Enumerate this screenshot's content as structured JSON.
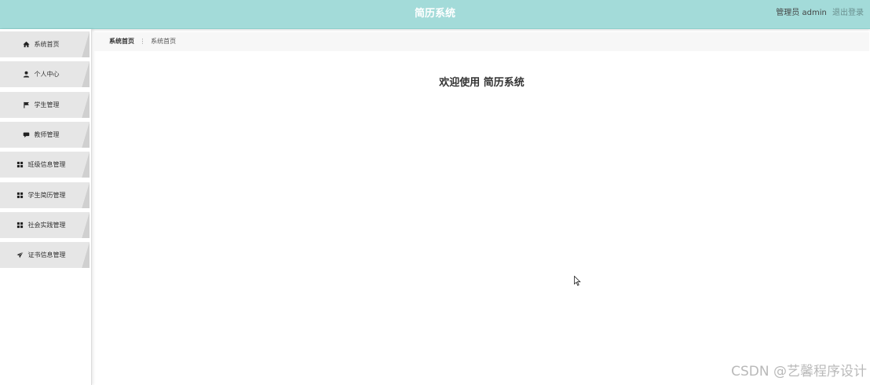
{
  "header": {
    "title": "简历系统",
    "user_label": "管理员 admin",
    "logout_label": "退出登录",
    "background_color": "#a3dbd9"
  },
  "sidebar": {
    "items": [
      {
        "label": "系统首页",
        "icon": "home-icon"
      },
      {
        "label": "个人中心",
        "icon": "user-icon"
      },
      {
        "label": "学生管理",
        "icon": "flag-icon"
      },
      {
        "label": "教师管理",
        "icon": "chat-icon"
      },
      {
        "label": "班级信息管理",
        "icon": "grid-icon"
      },
      {
        "label": "学生简历管理",
        "icon": "grid-icon"
      },
      {
        "label": "社会实践管理",
        "icon": "grid-icon"
      },
      {
        "label": "证书信息管理",
        "icon": "send-icon"
      }
    ]
  },
  "breadcrumb": {
    "first": "系统首页",
    "separator": "⋮",
    "second": "系统首页"
  },
  "main": {
    "welcome": "欢迎使用 简历系统"
  },
  "watermark": "CSDN @艺馨程序设计"
}
